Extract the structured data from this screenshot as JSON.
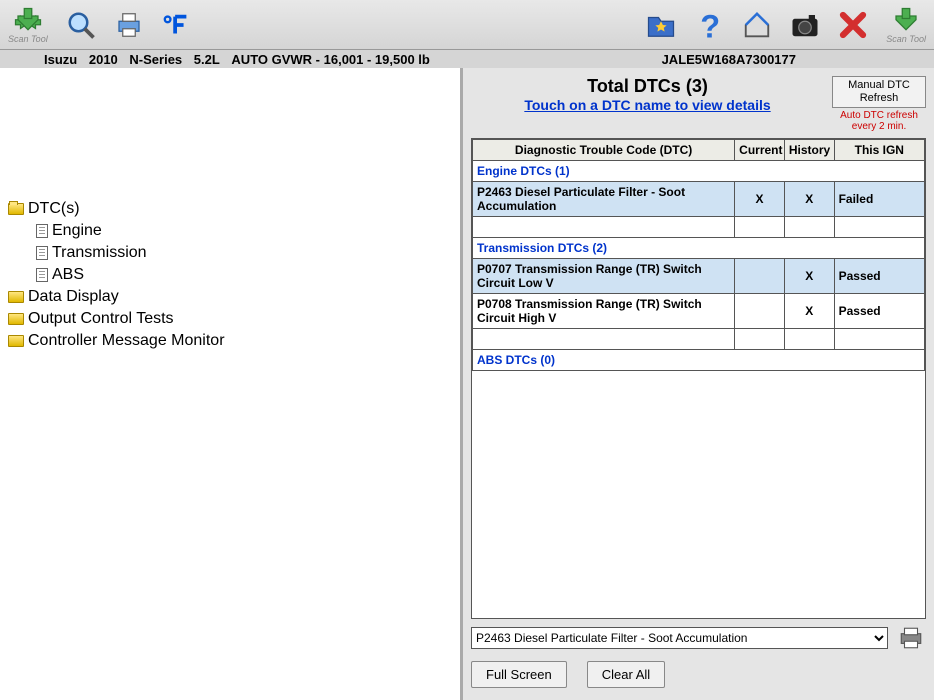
{
  "toolbar": {
    "scan_tool_left": "Scan Tool",
    "scan_tool_right": "Scan Tool"
  },
  "vehicle": {
    "make": "Isuzu",
    "year": "2010",
    "model": "N-Series",
    "engine": "5.2L",
    "trans": "AUTO GVWR - 16,001 - 19,500 lb",
    "vin": "JALE5W168A7300177"
  },
  "tree": {
    "dtcs": "DTC(s)",
    "engine": "Engine",
    "transmission": "Transmission",
    "abs": "ABS",
    "data_display": "Data Display",
    "output_tests": "Output Control Tests",
    "ctrl_msg_monitor": "Controller Message Monitor"
  },
  "right": {
    "total_label": "Total DTCs (3)",
    "touch_hint": "Touch on a DTC name to view details",
    "refresh_btn": "Manual DTC Refresh",
    "refresh_note": "Auto DTC refresh every 2 min.",
    "col_code": "Diagnostic Trouble Code (DTC)",
    "col_current": "Current",
    "col_history": "History",
    "col_ign": "This IGN",
    "sect_engine": "Engine DTCs (1)",
    "sect_trans": "Transmission DTCs (2)",
    "sect_abs": "ABS DTCs (0)",
    "row1_code": "P2463 Diesel Particulate Filter - Soot Accumulation",
    "row1_current": "X",
    "row1_history": "X",
    "row1_ign": "Failed",
    "row2_code": "P0707 Transmission Range (TR) Switch Circuit Low V",
    "row2_current": "",
    "row2_history": "X",
    "row2_ign": "Passed",
    "row3_code": "P0708 Transmission Range (TR) Switch Circuit High V",
    "row3_current": "",
    "row3_history": "X",
    "row3_ign": "Passed",
    "dropdown_selected": "P2463 Diesel Particulate Filter - Soot Accumulation",
    "btn_full": "Full Screen",
    "btn_clear": "Clear All"
  }
}
